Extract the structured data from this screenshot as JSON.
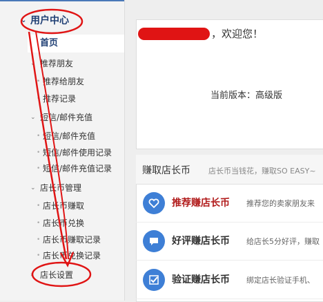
{
  "sidebar": {
    "header": {
      "label": "用户中心",
      "arrow": "⌄"
    },
    "home": {
      "label": "首页"
    },
    "sections": [
      {
        "label": "推荐朋友",
        "items": [
          "推荐给朋友",
          "推荐记录"
        ]
      },
      {
        "label": "短信/邮件充值",
        "items": [
          "短信/邮件充值",
          "短信/邮件使用记录",
          "短信/邮件充值记录"
        ]
      },
      {
        "label": "店长币管理",
        "items": [
          "店长币赚取",
          "店长币兑换",
          "店长币赚取记录",
          "店长币兑换记录"
        ]
      },
      {
        "label": "店长设置",
        "items": []
      }
    ]
  },
  "welcome": {
    "greeting": "，欢迎您！",
    "version": "当前版本：高级版"
  },
  "earn": {
    "title": "赚取店长币",
    "desc": "店长币当钱花，赚取SO EASY~",
    "rows": [
      {
        "name": "推荐赚店长币",
        "note": "推荐您的卖家朋友来",
        "icon": "heart-icon"
      },
      {
        "name": "好评赚店长币",
        "note": "给店长5分好评，赚取",
        "icon": "chat-icon"
      },
      {
        "name": "验证赚店长币",
        "note": "绑定店长验证手机、",
        "icon": "check-icon"
      }
    ]
  },
  "colors": {
    "accent": "#3e7fd6",
    "annotation": "#e01414",
    "header_text": "#1f3f74"
  }
}
